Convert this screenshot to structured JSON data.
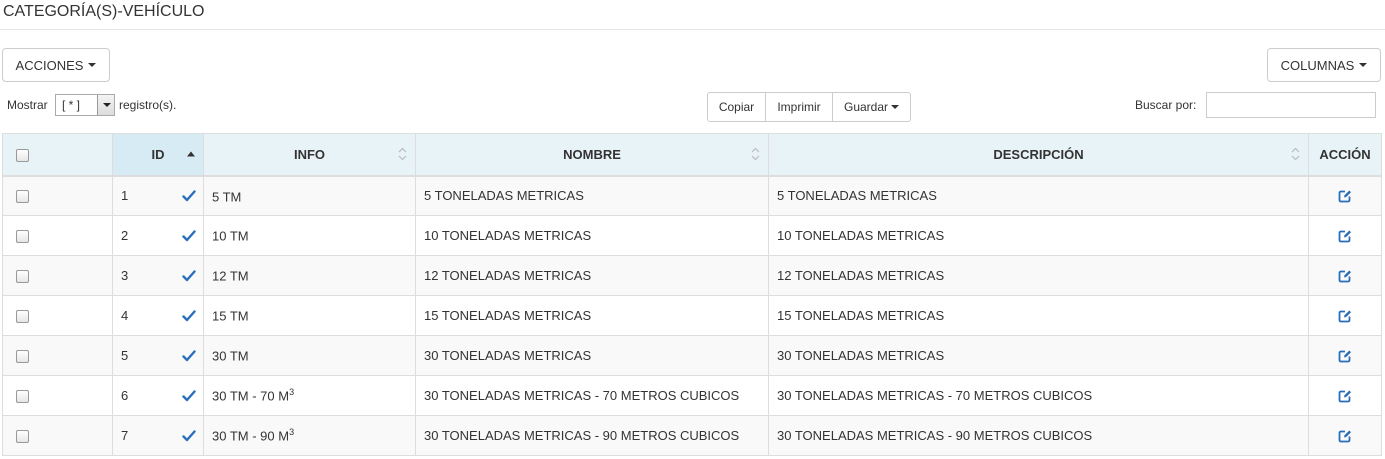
{
  "page": {
    "title": "CATEGORÍA(S)-VEHÍCULO"
  },
  "toolbar": {
    "acciones_label": "ACCIONES",
    "columnas_label": "COLUMNAS",
    "mostrar_label": "Mostrar",
    "page_size_value": "[ * ]",
    "registros_label": "registro(s).",
    "copiar_label": "Copiar",
    "imprimir_label": "Imprimir",
    "guardar_label": "Guardar",
    "buscar_label": "Buscar por:",
    "search_value": ""
  },
  "table": {
    "headers": {
      "id": "ID",
      "info": "INFO",
      "nombre": "NOMBRE",
      "descripcion": "DESCRIPCIÓN",
      "accion": "ACCIÓN"
    },
    "sorted_column": "ID",
    "rows": [
      {
        "id": "1",
        "info": "5 TM",
        "info_sup": "",
        "nombre": "5 TONELADAS METRICAS",
        "descripcion": "5 TONELADAS METRICAS"
      },
      {
        "id": "2",
        "info": "10 TM",
        "info_sup": "",
        "nombre": "10 TONELADAS METRICAS",
        "descripcion": "10 TONELADAS METRICAS"
      },
      {
        "id": "3",
        "info": "12 TM",
        "info_sup": "",
        "nombre": "12 TONELADAS METRICAS",
        "descripcion": "12 TONELADAS METRICAS"
      },
      {
        "id": "4",
        "info": "15 TM",
        "info_sup": "",
        "nombre": "15 TONELADAS METRICAS",
        "descripcion": "15 TONELADAS METRICAS"
      },
      {
        "id": "5",
        "info": "30 TM",
        "info_sup": "",
        "nombre": "30 TONELADAS METRICAS",
        "descripcion": "30 TONELADAS METRICAS"
      },
      {
        "id": "6",
        "info": "30 TM - 70 M",
        "info_sup": "3",
        "nombre": "30 TONELADAS METRICAS - 70 METROS CUBICOS",
        "descripcion": "30 TONELADAS METRICAS - 70 METROS CUBICOS"
      },
      {
        "id": "7",
        "info": "30 TM - 90 M",
        "info_sup": "3",
        "nombre": "30 TONELADAS METRICAS - 90 METROS CUBICOS",
        "descripcion": "30 TONELADAS METRICAS - 90 METROS CUBICOS"
      }
    ]
  },
  "colors": {
    "header_bg": "#e8f3f8",
    "sorted_header_bg": "#d7ebf5",
    "check_icon": "#2a6ebb",
    "edit_icon": "#2a6ebb"
  },
  "icons": {
    "row_status": "check-icon",
    "row_action": "edit-icon",
    "dropdown": "caret-down-icon"
  }
}
